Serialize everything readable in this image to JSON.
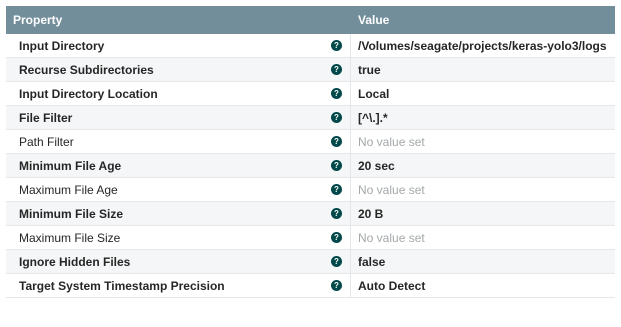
{
  "header": {
    "property": "Property",
    "value": "Value"
  },
  "colors": {
    "header_bg": "#728e9b",
    "help_icon": "#004849",
    "unset_text": "#a3a9ab"
  },
  "rows": [
    {
      "name": "Input Directory",
      "bold": true,
      "value": "/Volumes/seagate/projects/keras-yolo3/logs",
      "set": true,
      "icon": "help-icon"
    },
    {
      "name": "Recurse Subdirectories",
      "bold": true,
      "value": "true",
      "set": true,
      "icon": "help-icon"
    },
    {
      "name": "Input Directory Location",
      "bold": true,
      "value": "Local",
      "set": true,
      "icon": "help-icon"
    },
    {
      "name": "File Filter",
      "bold": true,
      "value": "[^\\.].*",
      "set": true,
      "icon": "help-icon"
    },
    {
      "name": "Path Filter",
      "bold": false,
      "value": "No value set",
      "set": false,
      "icon": "help-icon"
    },
    {
      "name": "Minimum File Age",
      "bold": true,
      "value": "20 sec",
      "set": true,
      "icon": "help-icon"
    },
    {
      "name": "Maximum File Age",
      "bold": false,
      "value": "No value set",
      "set": false,
      "icon": "help-icon"
    },
    {
      "name": "Minimum File Size",
      "bold": true,
      "value": "20 B",
      "set": true,
      "icon": "help-icon"
    },
    {
      "name": "Maximum File Size",
      "bold": false,
      "value": "No value set",
      "set": false,
      "icon": "help-icon"
    },
    {
      "name": "Ignore Hidden Files",
      "bold": true,
      "value": "false",
      "set": true,
      "icon": "help-icon"
    },
    {
      "name": "Target System Timestamp Precision",
      "bold": true,
      "value": "Auto Detect",
      "set": true,
      "icon": "help-icon"
    }
  ]
}
